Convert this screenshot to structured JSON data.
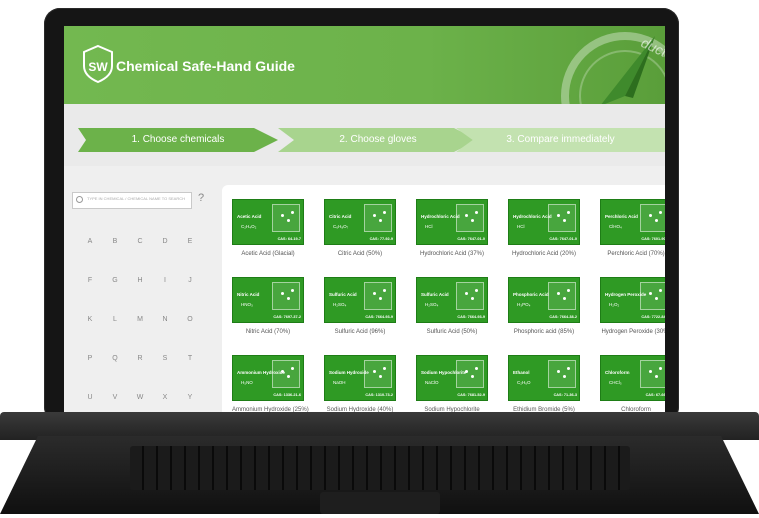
{
  "app": {
    "title": "Chemical Safe-Hand Guide",
    "logo_text": "SW",
    "banner_corner_text": "ducts"
  },
  "steps": [
    {
      "label": "1. Choose chemicals"
    },
    {
      "label": "2. Choose gloves"
    },
    {
      "label": "3. Compare immediately"
    }
  ],
  "search": {
    "placeholder": "TYPE IN CHEMICAL / CHEMICAL NAME TO SEARCH",
    "help": "?"
  },
  "alphabet": [
    "A",
    "B",
    "C",
    "D",
    "E",
    "F",
    "G",
    "H",
    "I",
    "J",
    "K",
    "L",
    "M",
    "N",
    "O",
    "P",
    "Q",
    "R",
    "S",
    "T",
    "U",
    "V",
    "W",
    "X",
    "Y"
  ],
  "chemicals": [
    {
      "tile_name": "Acetic Acid",
      "formula": "C₂H₄O₂",
      "cas": "CAS: 64-19-7",
      "label": "Acetic Acid (Glacial)"
    },
    {
      "tile_name": "Citric Acid",
      "formula": "C₆H₈O₇",
      "cas": "CAS: 77-92-9",
      "label": "Citric Acid (50%)"
    },
    {
      "tile_name": "Hydrochloric Acid",
      "formula": "HCl",
      "cas": "CAS: 7647-01-0",
      "label": "Hydrochloric Acid (37%)"
    },
    {
      "tile_name": "Hydrochloric Acid",
      "formula": "HCl",
      "cas": "CAS: 7647-01-0",
      "label": "Hydrochloric Acid (20%)"
    },
    {
      "tile_name": "Perchloric Acid",
      "formula": "ClHO₄",
      "cas": "CAS: 7601-90-3",
      "label": "Perchloric Acid (70%)"
    },
    {
      "tile_name": "Nitric Acid",
      "formula": "HNO₃",
      "cas": "CAS: 7697-37-2",
      "label": "Nitric Acid (70%)"
    },
    {
      "tile_name": "Sulfuric Acid",
      "formula": "H₂SO₄",
      "cas": "CAS: 7664-93-9",
      "label": "Sulfuric Acid (96%)"
    },
    {
      "tile_name": "Sulfuric Acid",
      "formula": "H₂SO₄",
      "cas": "CAS: 7664-93-9",
      "label": "Sulfuric Acid (50%)"
    },
    {
      "tile_name": "Phosphoric Acid",
      "formula": "H₃PO₄",
      "cas": "CAS: 7664-38-2",
      "label": "Phosphoric acid (85%)"
    },
    {
      "tile_name": "Hydrogen Peroxide",
      "formula": "H₂O₂",
      "cas": "CAS: 7722-84-1",
      "label": "Hydrogen Peroxide (30%)"
    },
    {
      "tile_name": "Ammonium Hydroxide",
      "formula": "H₅NO",
      "cas": "CAS: 1336-21-6",
      "label": "Ammonium Hydroxide (25%)"
    },
    {
      "tile_name": "Sodium Hydroxide",
      "formula": "NaOH",
      "cas": "CAS: 1310-73-2",
      "label": "Sodium Hydroxide (40%)"
    },
    {
      "tile_name": "Sodium Hypochlorite",
      "formula": "NaClO",
      "cas": "CAS: 7681-52-9",
      "label": "Sodium Hypochlorite"
    },
    {
      "tile_name": "Ethanol",
      "formula": "C₂H₆O",
      "cas": "CAS: 71-36-3",
      "label": "Ethidium Bromide (5%)"
    },
    {
      "tile_name": "Chloroform",
      "formula": "CHCl₃",
      "cas": "CAS: 67-66-3",
      "label": "Chloroform"
    }
  ],
  "colors": {
    "brand_green": "#6cb24a",
    "tile_green": "#2f9a24"
  }
}
